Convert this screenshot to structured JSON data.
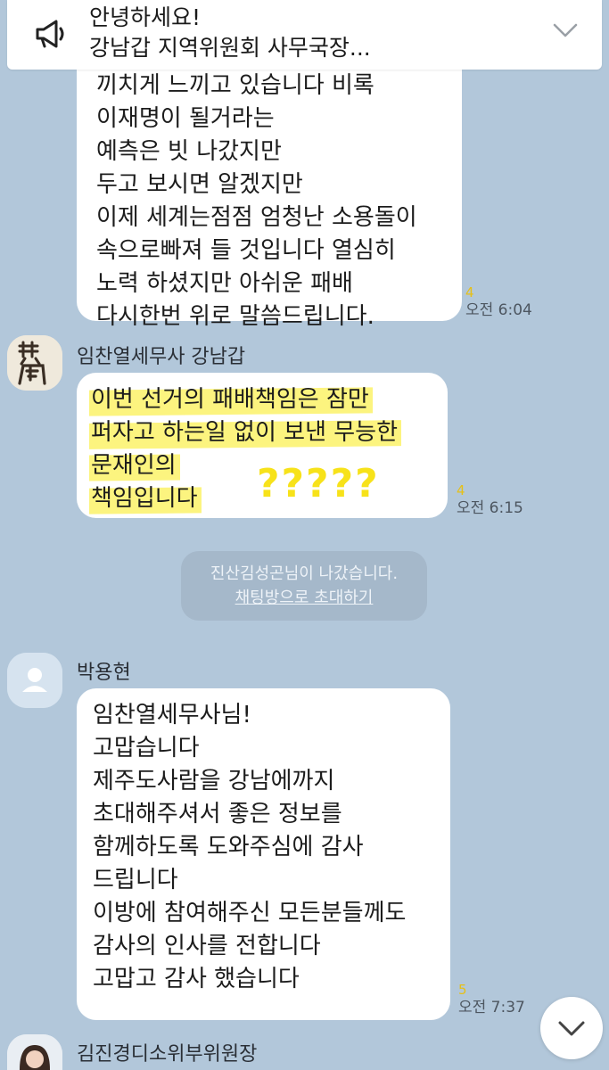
{
  "notice": {
    "icon": "megaphone-icon",
    "line1": "안녕하세요!",
    "line2": "강남갑 지역위원회 사무국장...",
    "expand_icon": "chevron-down-icon"
  },
  "messages": [
    {
      "lines": [
        "끼치게 느끼고 있습니다 비록",
        "이재명이 될거라는",
        "예측은 빗 나갔지만",
        "두고 보시면 알겠지만",
        "이제 세계는점점 엄청난 소용돌이",
        "속으로빠져 들 것입니다 열심히",
        "노력 하셨지만 아쉬운 패배",
        "다시한번 위로 말씀드립니다."
      ],
      "unread": "4",
      "time": "오전 6:04"
    },
    {
      "sender": "임찬열세무사 강남갑",
      "lines": [
        "이번 선거의 패배책임은 잠만",
        "퍼자고  하는일 없이 보낸 무능한",
        "문재인의",
        "책임입니다"
      ],
      "annotation": "?????",
      "unread": "4",
      "time": "오전 6:15"
    },
    {
      "sender": "박용현",
      "lines": [
        "임찬열세무사님!",
        "고맙습니다",
        "제주도사람을 강남에까지",
        "초대해주셔서 좋은 정보를",
        "함께하도록 도와주심에 감사",
        "드립니다",
        "이방에 참여해주신 모든분들께도",
        "감사의 인사를 전합니다",
        "고맙고 감사 했습니다"
      ],
      "unread": "5",
      "time": "오전 7:37"
    },
    {
      "sender": "김진경디소위부위원장"
    }
  ],
  "system": {
    "text": "진산김성곤님이 나갔습니다.",
    "link": "채팅방으로 초대하기"
  },
  "scroll_button_icon": "chevron-down-icon",
  "colors": {
    "background": "#b2c7da",
    "bubble": "#ffffff",
    "highlight": "#fbf269",
    "unread": "#e6c017"
  }
}
